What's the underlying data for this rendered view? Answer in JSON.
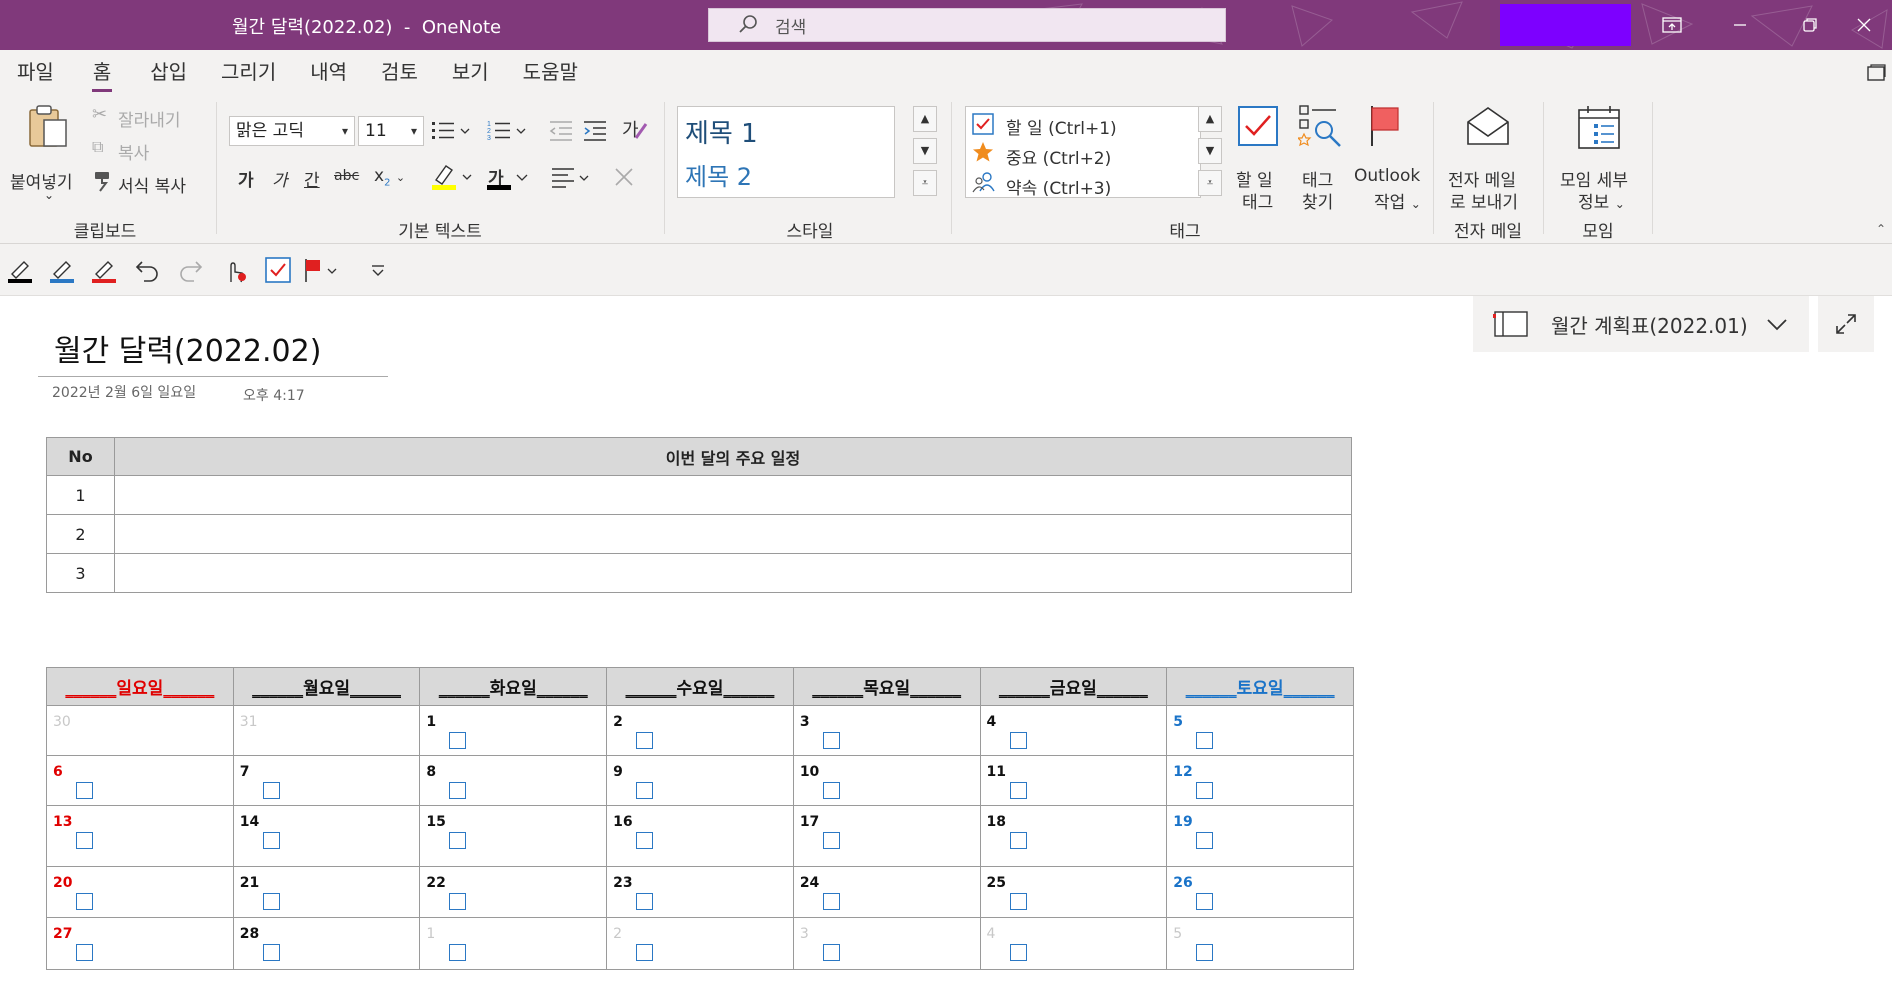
{
  "window": {
    "title": "월간 달력(2022.02)  -  OneNote",
    "search_placeholder": "검색"
  },
  "menu_tabs": [
    "파일",
    "홈",
    "삽입",
    "그리기",
    "내역",
    "검토",
    "보기",
    "도움말"
  ],
  "active_tab": "홈",
  "ribbon": {
    "clipboard": {
      "paste": "붙여넣기",
      "cut": "잘라내기",
      "copy": "복사",
      "format_painter": "서식 복사",
      "label": "클립보드"
    },
    "basic_text": {
      "font": "맑은 고딕",
      "size": "11",
      "bold": "가",
      "italic": "가",
      "underline": "간",
      "strike": "abc",
      "font_color_glyph": "가",
      "label": "기본 텍스트"
    },
    "styles": {
      "heading1": "제목 1",
      "heading2": "제목 2",
      "label": "스타일"
    },
    "tags": {
      "todo": "할 일 (Ctrl+1)",
      "important": "중요 (Ctrl+2)",
      "appointment": "약속 (Ctrl+3)",
      "todo_tag_line1": "할 일",
      "todo_tag_line2": "태그",
      "find_tags_line1": "태그",
      "find_tags_line2": "찾기",
      "outlook_line1": "Outlook",
      "outlook_line2": "작업",
      "label": "태그"
    },
    "email": {
      "line1": "전자 메일",
      "line2": "로 보내기",
      "label": "전자 메일"
    },
    "meeting": {
      "line1": "모임 세부",
      "line2": "정보",
      "label": "모임"
    }
  },
  "page": {
    "title": "월간 달력(2022.02)",
    "date": "2022년 2월 6일 일요일",
    "time": "오후 4:17",
    "nav_page": "월간 계획표(2022.01)"
  },
  "schedule_table": {
    "headers": [
      "No",
      "이번 달의 주요 일정"
    ],
    "rows": [
      {
        "no": "1",
        "text": ""
      },
      {
        "no": "2",
        "text": ""
      },
      {
        "no": "3",
        "text": ""
      }
    ]
  },
  "calendar": {
    "day_headers": [
      "일요일",
      "월요일",
      "화요일",
      "수요일",
      "목요일",
      "금요일",
      "토요일"
    ],
    "weeks": [
      [
        "30",
        "31",
        "1",
        "2",
        "3",
        "4",
        "5"
      ],
      [
        "6",
        "7",
        "8",
        "9",
        "10",
        "11",
        "12"
      ],
      [
        "13",
        "14",
        "15",
        "16",
        "17",
        "18",
        "19"
      ],
      [
        "20",
        "21",
        "22",
        "23",
        "24",
        "25",
        "26"
      ],
      [
        "27",
        "28",
        "1",
        "2",
        "3",
        "4",
        "5"
      ]
    ],
    "colors": {
      "sunday": "#e00000",
      "saturday": "#1a73c8",
      "other_month": "#c8c8c8"
    }
  },
  "colors": {
    "titlebar": "#80397b",
    "ribbon": "#f3f2f1",
    "accent": "#80397b"
  }
}
